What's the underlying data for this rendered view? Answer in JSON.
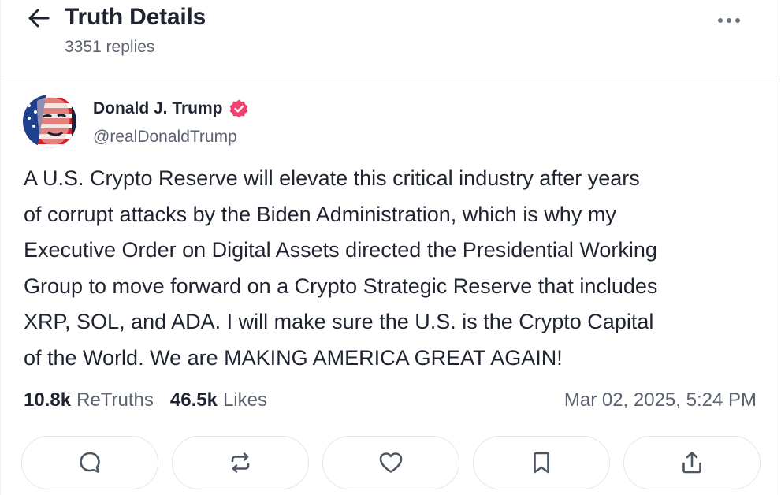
{
  "header": {
    "title": "Truth Details",
    "replies": "3351 replies",
    "back_icon": "arrow-left-icon",
    "more_icon": "more-horizontal-icon"
  },
  "post": {
    "author": {
      "name": "Donald J. Trump",
      "handle": "@realDonaldTrump",
      "verified_icon": "verified-badge-icon",
      "verified_color": "#f2406f"
    },
    "body": "A U.S. Crypto Reserve will elevate this critical industry after years\nof corrupt attacks by the Biden Administration, which is why my\nExecutive Order on Digital Assets directed the Presidential Working\nGroup to move forward on a Crypto Strategic Reserve that includes\nXRP, SOL, and ADA. I will make sure the U.S. is the Crypto Capital\nof the World. We are MAKING AMERICA GREAT AGAIN!",
    "stats": {
      "retruths_count": "10.8k",
      "retruths_label": "ReTruths",
      "likes_count": "46.5k",
      "likes_label": "Likes"
    },
    "timestamp": "Mar 02, 2025, 5:24 PM"
  },
  "actions": [
    {
      "icon": "reply-icon"
    },
    {
      "icon": "retruth-icon"
    },
    {
      "icon": "heart-icon"
    },
    {
      "icon": "bookmark-icon"
    },
    {
      "icon": "share-icon"
    }
  ],
  "colors": {
    "text_primary": "#1f2430",
    "text_secondary": "#5b6270",
    "border": "#e3e5e9",
    "icon": "#4b5563"
  }
}
